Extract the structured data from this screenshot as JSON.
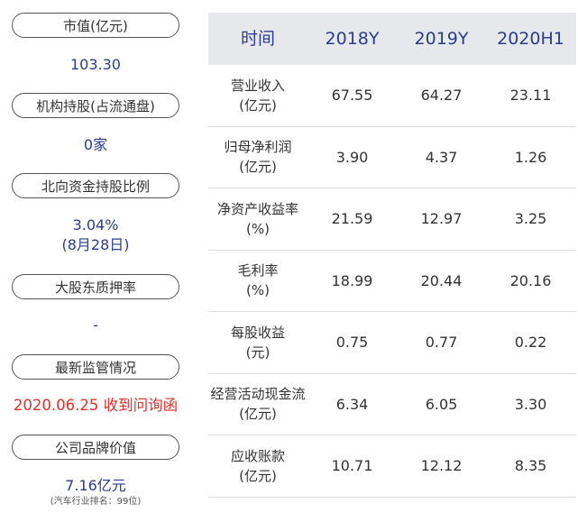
{
  "left": {
    "items": [
      {
        "label": "市值(亿元)",
        "value": "103.30"
      },
      {
        "label": "机构持股(占流通盘)",
        "value": "0家"
      },
      {
        "label": "北向资金持股比例",
        "value": "3.04%",
        "value2": "(8月28日)"
      },
      {
        "label": "大股东质押率",
        "value": "-"
      },
      {
        "label": "最新监管情况",
        "value": "2020.06.25 收到问询函"
      },
      {
        "label": "公司品牌价值",
        "value": "7.16亿元",
        "note": "(汽车行业排名：99位)"
      }
    ]
  },
  "table": {
    "headers": [
      "时间",
      "2018Y",
      "2019Y",
      "2020H1"
    ],
    "rows": [
      {
        "name": "营业收入",
        "unit": "(亿元)",
        "values": [
          "67.55",
          "64.27",
          "23.11"
        ]
      },
      {
        "name": "归母净利润",
        "unit": "(亿元)",
        "values": [
          "3.90",
          "4.37",
          "1.26"
        ]
      },
      {
        "name": "净资产收益率",
        "unit": "(%)",
        "values": [
          "21.59",
          "12.97",
          "3.25"
        ]
      },
      {
        "name": "毛利率",
        "unit": "(%)",
        "values": [
          "18.99",
          "20.44",
          "20.16"
        ]
      },
      {
        "name": "每股收益",
        "unit": "(元)",
        "values": [
          "0.75",
          "0.77",
          "0.22"
        ]
      },
      {
        "name": "经营活动现金流",
        "unit": "(亿元)",
        "values": [
          "6.34",
          "6.05",
          "3.30"
        ]
      },
      {
        "name": "应收账款",
        "unit": "(亿元)",
        "values": [
          "10.71",
          "12.12",
          "8.35"
        ]
      }
    ]
  },
  "colors": {
    "accent": "#2a3d8f",
    "alert": "#e0312b",
    "header_bg": "#e6e8ec"
  }
}
